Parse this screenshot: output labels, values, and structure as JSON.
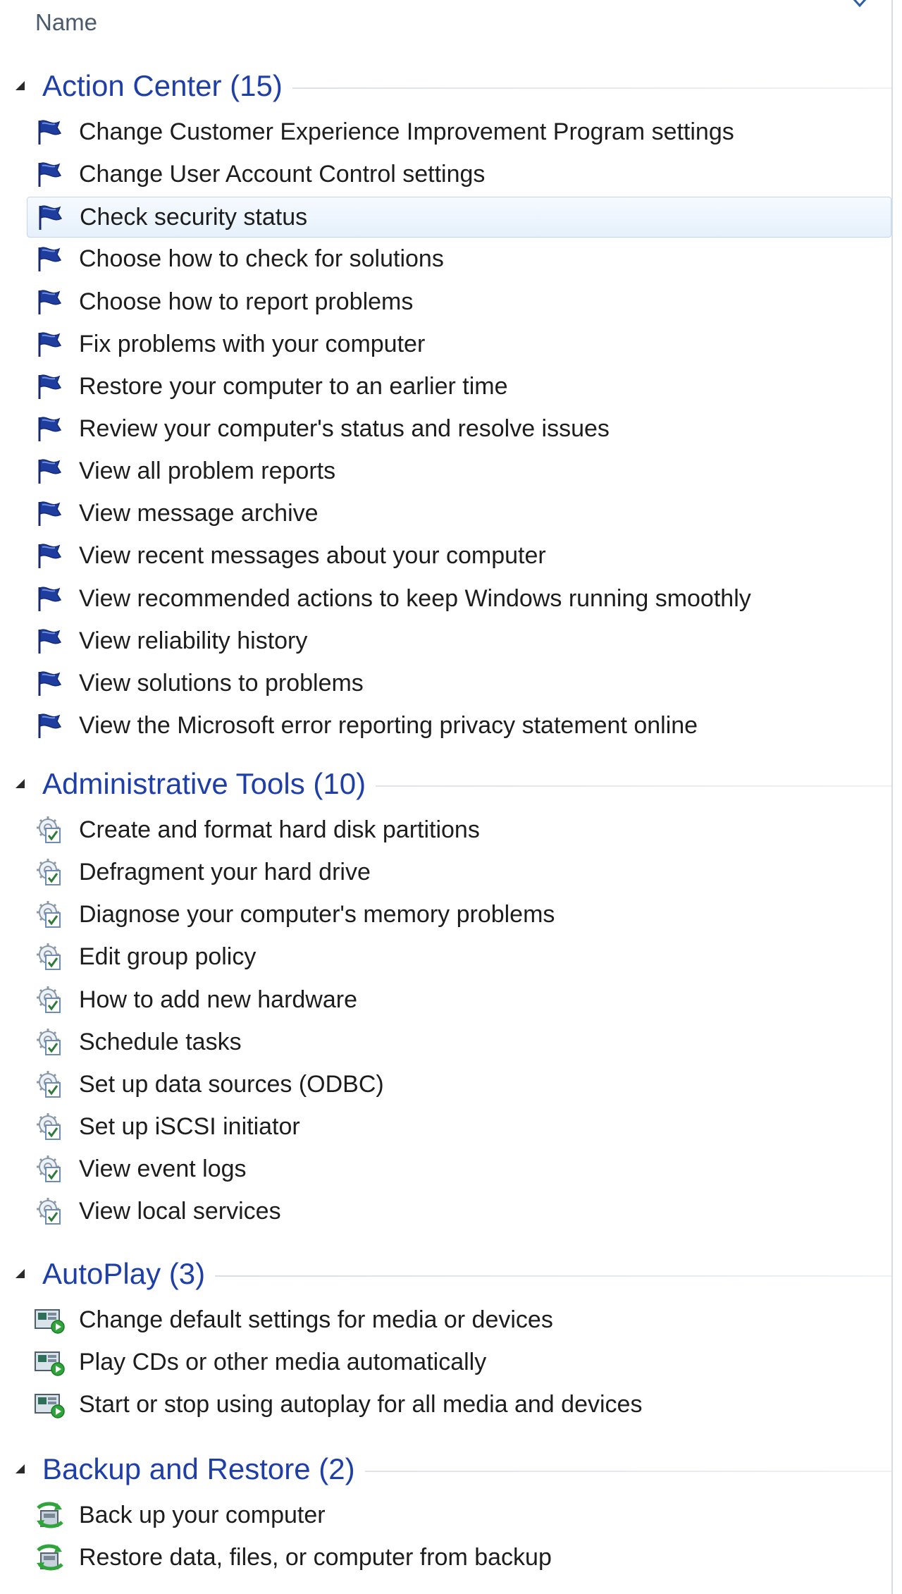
{
  "header": {
    "column_name": "Name"
  },
  "groups": [
    {
      "title": "Action Center (15)",
      "icon": "flag-icon",
      "items": [
        "Change Customer Experience Improvement Program settings",
        "Change User Account Control settings",
        "Check security status",
        "Choose how to check for solutions",
        "Choose how to report problems",
        "Fix problems with your computer",
        "Restore your computer to an earlier time",
        "Review your computer's status and resolve issues",
        "View all problem reports",
        "View message archive",
        "View recent messages about your computer",
        "View recommended actions to keep Windows running smoothly",
        "View reliability history",
        "View solutions to problems",
        "View the Microsoft error reporting privacy statement online"
      ]
    },
    {
      "title": "Administrative Tools (10)",
      "icon": "admin-tools-icon",
      "items": [
        "Create and format hard disk partitions",
        "Defragment your hard drive",
        "Diagnose your computer's memory problems",
        "Edit group policy",
        "How to add new hardware",
        "Schedule tasks",
        "Set up data sources (ODBC)",
        "Set up iSCSI initiator",
        "View event logs",
        "View local services"
      ]
    },
    {
      "title": "AutoPlay (3)",
      "icon": "autoplay-icon",
      "items": [
        "Change default settings for media or devices",
        "Play CDs or other media automatically",
        "Start or stop using autoplay for all media and devices"
      ]
    },
    {
      "title": "Backup and Restore (2)",
      "icon": "backup-restore-icon",
      "items": [
        "Back up your computer",
        "Restore data, files, or computer from backup"
      ]
    }
  ],
  "selected_item": "Check security status"
}
